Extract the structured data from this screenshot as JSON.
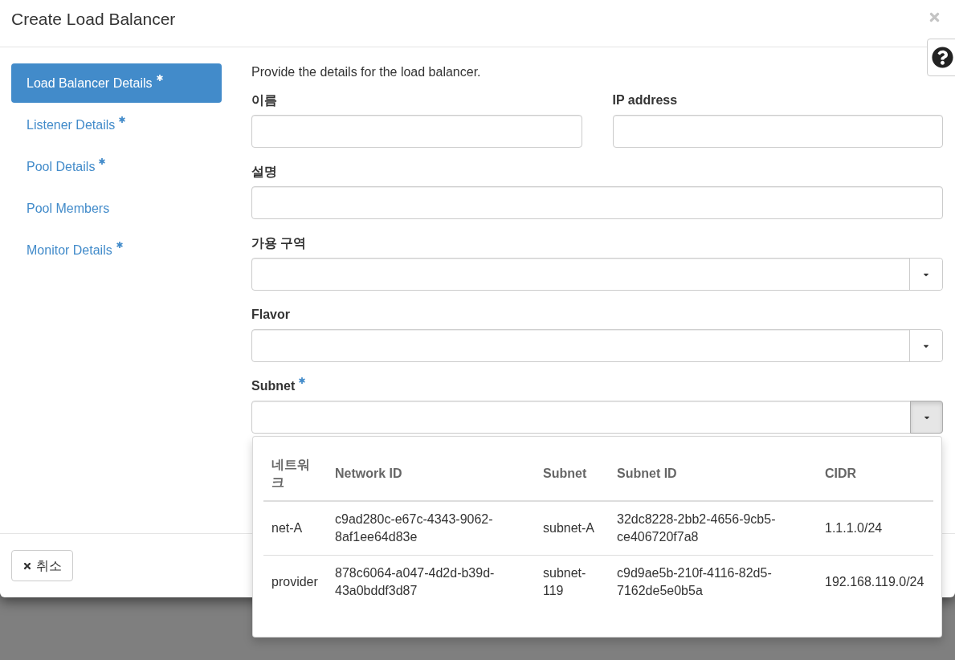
{
  "modal": {
    "title": "Create Load Balancer"
  },
  "steps": [
    {
      "label": "Load Balancer Details",
      "required": true,
      "selected": true
    },
    {
      "label": "Listener Details",
      "required": true,
      "selected": false
    },
    {
      "label": "Pool Details",
      "required": true,
      "selected": false
    },
    {
      "label": "Pool Members",
      "required": false,
      "selected": false
    },
    {
      "label": "Monitor Details",
      "required": true,
      "selected": false
    }
  ],
  "form": {
    "description": "Provide the details for the load balancer.",
    "rows": [
      [
        {
          "label": "이름",
          "kind": "text",
          "required": false
        },
        {
          "label": "IP address",
          "kind": "text",
          "required": false
        }
      ],
      [
        {
          "label": "설명",
          "kind": "text",
          "required": false
        }
      ],
      [
        {
          "label": "가용 구역",
          "kind": "select",
          "required": false,
          "expanded": false
        }
      ],
      [
        {
          "label": "Flavor",
          "kind": "select",
          "required": false,
          "expanded": false
        }
      ],
      [
        {
          "label": "Subnet",
          "kind": "select",
          "required": true,
          "expanded": true,
          "table": {
            "columns": [
              "네트워크",
              "Network ID",
              "Subnet",
              "Subnet ID",
              "CIDR"
            ],
            "rows": [
              [
                "net-A",
                "c9ad280c-e67c-4343-9062-8af1ee64d83e",
                "subnet-A",
                "32dc8228-2bb2-4656-9cb5-ce406720f7a8",
                "1.1.1.0/24"
              ],
              [
                "provider",
                "878c6064-a047-4d2d-b39d-43a0bddf3d87",
                "subnet-119",
                "c9d9ae5b-210f-4116-82d5-7162de5e0b5a",
                "192.168.119.0/24"
              ]
            ]
          }
        }
      ]
    ]
  },
  "footer": {
    "buttons": [
      {
        "label": "취소",
        "kind": "cancel"
      }
    ]
  }
}
